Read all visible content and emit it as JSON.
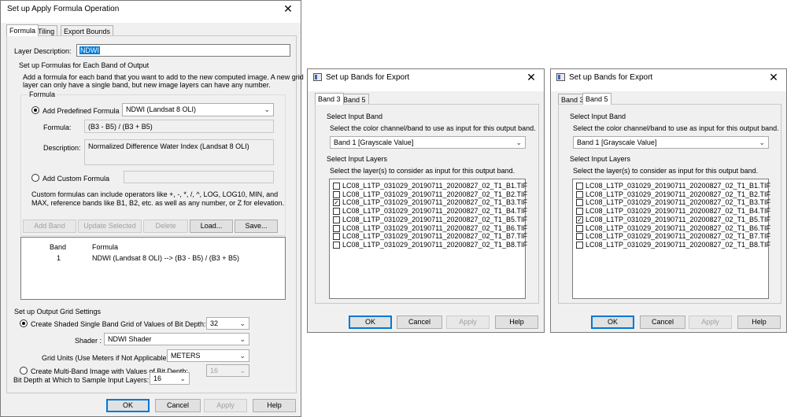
{
  "formula_dialog": {
    "title": "Set up Apply Formula Operation",
    "close_glyph": "✕",
    "tabs": [
      "Formula",
      "Tiling",
      "Export Bounds"
    ],
    "layer_description_label": "Layer Description:",
    "layer_description_value": "NDWI",
    "formulas_header": "Set up Formulas for Each Band of Output",
    "formulas_help": [
      "Add a formula for each band that you want to add to the new computed image. A new grid",
      "layer can only have a single band, but new image layers can have any number."
    ],
    "formula_group_label": "Formula",
    "predefined_radio_label": "Add Predefined Formula",
    "predefined_selected": "NDWI (Landsat 8 OLI)",
    "formula_label": "Formula:",
    "formula_value": "(B3 - B5) / (B3 + B5)",
    "description_label": "Description:",
    "description_value": "Normalized Difference Water Index (Landsat 8 OLI)",
    "custom_radio_label": "Add Custom Formula",
    "custom_help": [
      "Custom formulas can include operators like +, -, *, /, ^, LOG, LOG10, MIN, and",
      "MAX, reference bands like B1, B2, etc. as well as any number, or Z for elevation."
    ],
    "buttons_row": {
      "add_band": "Add Band",
      "update_selected": "Update Selected",
      "delete": "Delete",
      "load": "Load...",
      "save": "Save..."
    },
    "band_table": {
      "columns": [
        "Band",
        "Formula"
      ],
      "rows": [
        {
          "band": "1",
          "formula": "NDWI (Landsat 8 OLI)  -->  (B3 - B5) / (B3 + B5)"
        }
      ]
    },
    "grid_settings_header": "Set up Output Grid Settings",
    "shaded_radio_label": "Create Shaded Single Band Grid of Values of Bit Depth:",
    "shaded_bit_depth": "32",
    "shader_label": "Shader :",
    "shader_value": "NDWI Shader",
    "grid_units_label": "Grid Units (Use Meters if Not Applicable):",
    "grid_units_value": "METERS",
    "multiband_radio_label": "Create Multi-Band Image with Values of Bit Depth:",
    "multiband_bit_depth": "16",
    "sample_depth_label": "Bit Depth at Which to Sample Input Layers:",
    "sample_depth_value": "16",
    "footer": {
      "ok": "OK",
      "cancel": "Cancel",
      "apply": "Apply",
      "help": "Help"
    }
  },
  "band_dialogs": [
    {
      "title": "Set up Bands for Export",
      "close_glyph": "✕",
      "tabs": [
        "Band 3",
        "Band 5"
      ],
      "active_tab": 0,
      "input_band_header": "Select Input Band",
      "input_band_help": "Select the color channel/band to use as input for this output band.",
      "input_band_value": "Band 1 [Grayscale Value]",
      "input_layers_header": "Select Input Layers",
      "input_layers_help": "Select the layer(s) to consider as input for this output band.",
      "layers": [
        {
          "name": "LC08_L1TP_031029_20190711_20200827_02_T1_B1.TIF",
          "checked": false
        },
        {
          "name": "LC08_L1TP_031029_20190711_20200827_02_T1_B2.TIF",
          "checked": false
        },
        {
          "name": "LC08_L1TP_031029_20190711_20200827_02_T1_B3.TIF",
          "checked": true
        },
        {
          "name": "LC08_L1TP_031029_20190711_20200827_02_T1_B4.TIF",
          "checked": false
        },
        {
          "name": "LC08_L1TP_031029_20190711_20200827_02_T1_B5.TIF",
          "checked": false
        },
        {
          "name": "LC08_L1TP_031029_20190711_20200827_02_T1_B6.TIF",
          "checked": false
        },
        {
          "name": "LC08_L1TP_031029_20190711_20200827_02_T1_B7.TIF",
          "checked": false
        },
        {
          "name": "LC08_L1TP_031029_20190711_20200827_02_T1_B8.TIF",
          "checked": false
        }
      ],
      "footer": {
        "ok": "OK",
        "cancel": "Cancel",
        "apply": "Apply",
        "help": "Help"
      }
    },
    {
      "title": "Set up Bands for Export",
      "close_glyph": "✕",
      "tabs": [
        "Band 3",
        "Band 5"
      ],
      "active_tab": 1,
      "input_band_header": "Select Input Band",
      "input_band_help": "Select the color channel/band to use as input for this output band.",
      "input_band_value": "Band 1 [Grayscale Value]",
      "input_layers_header": "Select Input Layers",
      "input_layers_help": "Select the layer(s) to consider as input for this output band.",
      "layers": [
        {
          "name": "LC08_L1TP_031029_20190711_20200827_02_T1_B1.TIF",
          "checked": false
        },
        {
          "name": "LC08_L1TP_031029_20190711_20200827_02_T1_B2.TIF",
          "checked": false
        },
        {
          "name": "LC08_L1TP_031029_20190711_20200827_02_T1_B3.TIF",
          "checked": false
        },
        {
          "name": "LC08_L1TP_031029_20190711_20200827_02_T1_B4.TIF",
          "checked": false
        },
        {
          "name": "LC08_L1TP_031029_20190711_20200827_02_T1_B5.TIF",
          "checked": true
        },
        {
          "name": "LC08_L1TP_031029_20190711_20200827_02_T1_B6.TIF",
          "checked": false
        },
        {
          "name": "LC08_L1TP_031029_20190711_20200827_02_T1_B7.TIF",
          "checked": false
        },
        {
          "name": "LC08_L1TP_031029_20190711_20200827_02_T1_B8.TIF",
          "checked": false
        }
      ],
      "footer": {
        "ok": "OK",
        "cancel": "Cancel",
        "apply": "Apply",
        "help": "Help"
      }
    }
  ],
  "icons": {
    "dropdown": "chevron-down-icon",
    "check": "checkmark-icon",
    "close": "close-icon",
    "window": "window-icon"
  },
  "colors": {
    "selection": "#0078d7",
    "dialog_bg": "#f0f0f0",
    "default_button_border": "#0078d7"
  }
}
